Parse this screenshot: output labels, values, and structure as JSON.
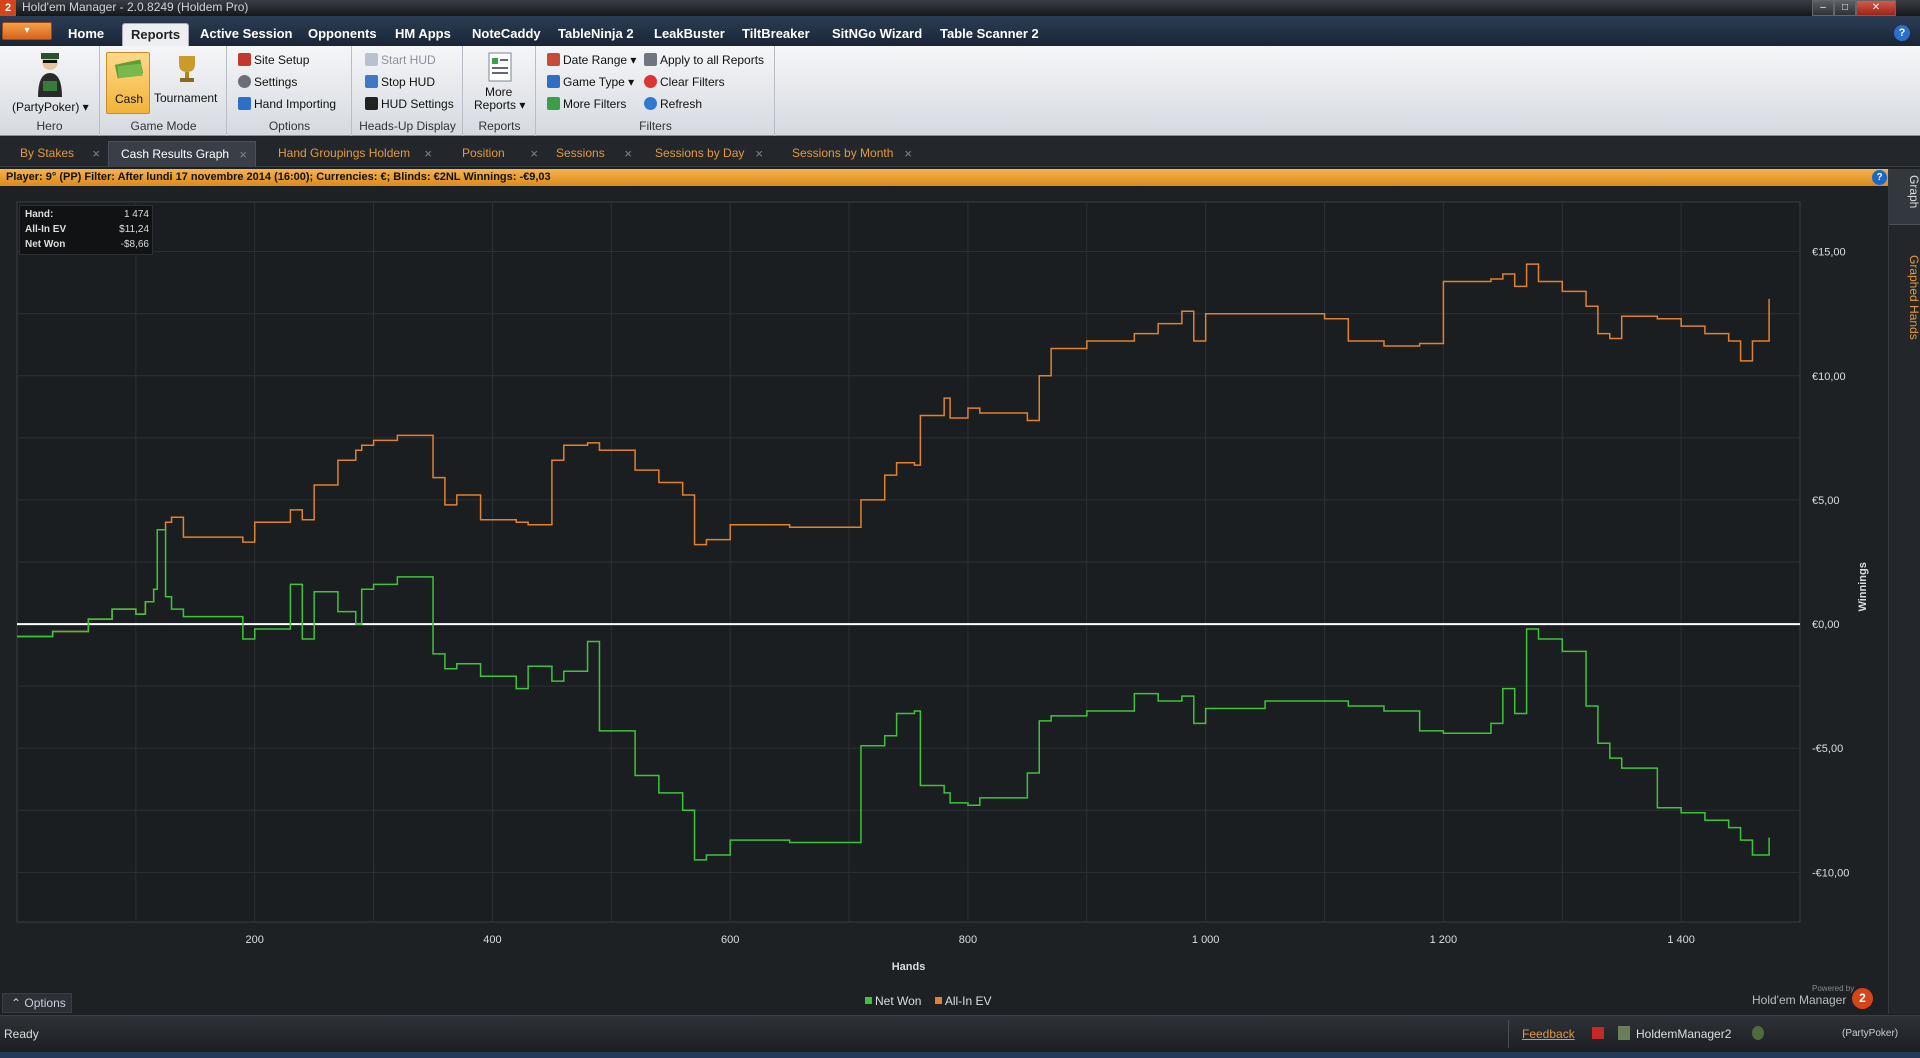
{
  "window": {
    "title": "Hold'em Manager - 2.0.8249 (Holdem Pro)",
    "logo": "2"
  },
  "menu": {
    "app_button": "▾",
    "tabs": [
      "Home",
      "Reports",
      "Active Session",
      "Opponents",
      "HM Apps",
      "NoteCaddy",
      "TableNinja 2",
      "LeakBuster",
      "TiltBreaker",
      "SitNGo Wizard",
      "Table Scanner 2"
    ],
    "active": "Reports",
    "help": "?"
  },
  "ribbon": {
    "hero": {
      "label": "(PartyPoker) ▾",
      "group": "Hero"
    },
    "game_mode": {
      "cash": "Cash",
      "tournament": "Tournament",
      "group": "Game Mode"
    },
    "options": {
      "site_setup": "Site Setup",
      "settings": "Settings",
      "hand_importing": "Hand Importing",
      "group": "Options"
    },
    "hud": {
      "start": "Start HUD",
      "stop": "Stop HUD",
      "settings": "HUD Settings",
      "group": "Heads-Up Display"
    },
    "reports": {
      "more_line1": "More",
      "more_line2": "Reports ▾",
      "group": "Reports"
    },
    "filters": {
      "date_range": "Date Range ▾",
      "game_type": "Game Type ▾",
      "more_filters": "More Filters",
      "apply_all": "Apply to all Reports",
      "clear": "Clear Filters",
      "refresh": "Refresh",
      "group": "Filters"
    }
  },
  "doc_tabs": [
    "By Stakes",
    "Cash Results Graph",
    "Hand Groupings Holdem",
    "Position",
    "Sessions",
    "Sessions by Day",
    "Sessions by Month"
  ],
  "doc_tab_active": "Cash Results Graph",
  "filter_bar": {
    "text": "Player: 9°          (PP)  Filter:  After lundi 17 novembre 2014 (16:00); Currencies: €; Blinds: €2NL  Winnings:  -€9,03",
    "help": "?"
  },
  "side_tabs": {
    "graph": "Graph",
    "graphed_hands": "Graphed Hands"
  },
  "stats": {
    "hand_label": "Hand:",
    "hand_value": "1 474",
    "ev_label": "All-In EV",
    "ev_value": "$11,24",
    "net_label": "Net Won",
    "net_value": "-$8,66"
  },
  "chart_data": {
    "type": "line",
    "xlabel": "Hands",
    "ylabel": "Winnings",
    "xlim": [
      0,
      1500
    ],
    "ylim": [
      -12,
      17
    ],
    "x_ticks": [
      200,
      400,
      600,
      800,
      1000,
      1200,
      1400
    ],
    "x_tick_labels": [
      "200",
      "400",
      "600",
      "800",
      "1 000",
      "1 200",
      "1 400"
    ],
    "y_ticks": [
      15,
      10,
      5,
      0,
      -5,
      -10
    ],
    "y_tick_labels": [
      "€15,00",
      "€10,00",
      "€5,00",
      "€0,00",
      "-€5,00",
      "-€10,00"
    ],
    "grid": true,
    "legend_position": "bottom-center",
    "series": [
      {
        "name": "Net Won",
        "color": "#3ec43a",
        "x": [
          0,
          30,
          60,
          80,
          100,
          108,
          115,
          118,
          125,
          130,
          140,
          190,
          200,
          230,
          240,
          250,
          270,
          285,
          290,
          300,
          320,
          350,
          360,
          370,
          390,
          420,
          430,
          450,
          460,
          480,
          490,
          520,
          540,
          560,
          570,
          580,
          600,
          650,
          700,
          710,
          730,
          740,
          755,
          760,
          780,
          785,
          800,
          810,
          850,
          860,
          870,
          900,
          940,
          960,
          980,
          990,
          1000,
          1050,
          1100,
          1120,
          1150,
          1180,
          1200,
          1240,
          1250,
          1260,
          1270,
          1280,
          1300,
          1320,
          1330,
          1340,
          1350,
          1380,
          1400,
          1420,
          1440,
          1450,
          1460,
          1474
        ],
        "y": [
          -0.5,
          -0.3,
          0.2,
          0.6,
          0.4,
          0.9,
          1.4,
          3.8,
          1.1,
          0.6,
          0.3,
          -0.6,
          -0.2,
          1.6,
          -0.6,
          1.3,
          0.5,
          0,
          1.4,
          1.6,
          1.9,
          -1.2,
          -1.8,
          -1.6,
          -2.1,
          -2.6,
          -1.7,
          -2.3,
          -1.9,
          -0.7,
          -4.3,
          -6.1,
          -6.8,
          -7.5,
          -9.5,
          -9.3,
          -8.7,
          -8.8,
          -8.8,
          -4.9,
          -4.5,
          -3.6,
          -3.5,
          -6.5,
          -6.8,
          -7.2,
          -7.3,
          -7.0,
          -6.0,
          -3.9,
          -3.7,
          -3.5,
          -2.8,
          -3.1,
          -2.9,
          -4.0,
          -3.4,
          -3.1,
          -3.1,
          -3.3,
          -3.5,
          -4.3,
          -4.4,
          -4.0,
          -2.6,
          -3.6,
          -0.2,
          -0.6,
          -1.1,
          -3.3,
          -4.8,
          -5.4,
          -5.8,
          -7.4,
          -7.6,
          -7.9,
          -8.2,
          -8.7,
          -9.3,
          -8.6
        ]
      },
      {
        "name": "All-In EV",
        "color": "#e0822e",
        "x": [
          0,
          30,
          60,
          80,
          100,
          108,
          115,
          118,
          125,
          130,
          140,
          190,
          200,
          230,
          240,
          250,
          270,
          285,
          290,
          300,
          320,
          350,
          360,
          370,
          390,
          420,
          430,
          450,
          460,
          480,
          490,
          520,
          540,
          560,
          570,
          580,
          600,
          650,
          700,
          710,
          730,
          740,
          755,
          760,
          780,
          785,
          800,
          810,
          850,
          860,
          870,
          900,
          940,
          960,
          980,
          990,
          1000,
          1050,
          1100,
          1120,
          1150,
          1180,
          1200,
          1240,
          1250,
          1260,
          1270,
          1280,
          1300,
          1320,
          1330,
          1340,
          1350,
          1380,
          1400,
          1420,
          1440,
          1450,
          1460,
          1474
        ],
        "y": [
          -0.5,
          -0.3,
          0.2,
          0.6,
          0.4,
          0.9,
          1.4,
          3.8,
          4.1,
          4.3,
          3.5,
          3.3,
          4.1,
          4.6,
          4.2,
          5.6,
          6.6,
          7.0,
          7.2,
          7.4,
          7.6,
          5.9,
          4.8,
          5.2,
          4.2,
          4.1,
          4.0,
          6.6,
          7.2,
          7.3,
          7.0,
          6.2,
          5.7,
          5.2,
          3.2,
          3.4,
          4.0,
          3.9,
          3.9,
          5.0,
          6.0,
          6.5,
          6.4,
          8.4,
          9.1,
          8.3,
          8.7,
          8.5,
          8.2,
          10.0,
          11.1,
          11.4,
          11.7,
          12.1,
          12.6,
          11.4,
          12.5,
          12.5,
          12.3,
          11.4,
          11.2,
          11.3,
          13.8,
          13.9,
          14.1,
          13.6,
          14.5,
          13.8,
          13.4,
          12.8,
          11.7,
          11.5,
          12.4,
          12.3,
          12.0,
          11.7,
          11.4,
          10.6,
          11.4,
          13.1
        ]
      }
    ]
  },
  "options_button": "Options",
  "brand": {
    "powered": "Powered by",
    "name": "Hold'em Manager",
    "badge": "2"
  },
  "status": {
    "ready": "Ready",
    "feedback": "Feedback",
    "app": "HoldemManager2",
    "site": "(PartyPoker)"
  }
}
